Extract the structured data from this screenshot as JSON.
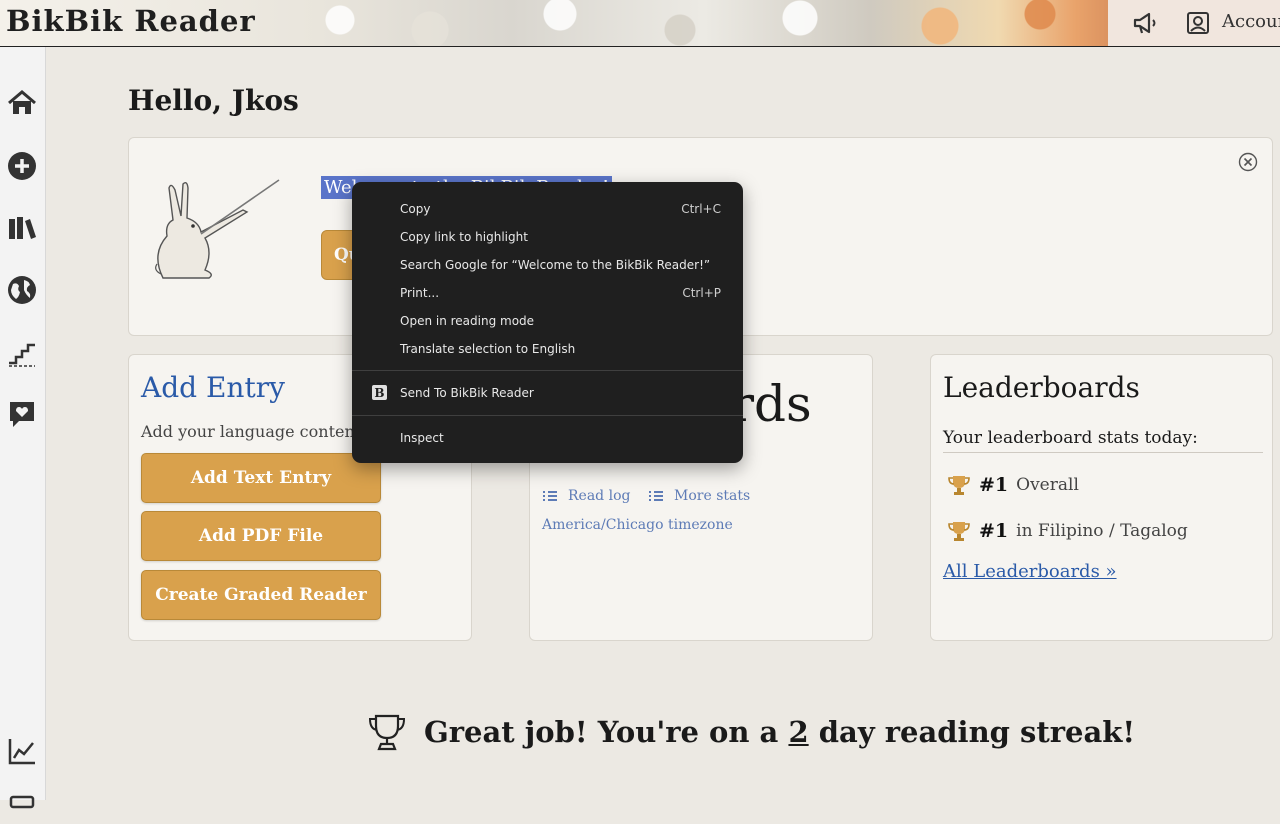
{
  "header": {
    "brand": "BikBik Reader",
    "account_label": "Account"
  },
  "sidebar": {
    "items": [
      "home-icon",
      "add-circle-icon",
      "library-icon",
      "globe-icon",
      "stairs-icon",
      "heart-chat-icon",
      "stats-chart-icon"
    ]
  },
  "greeting": "Hello, Jkos",
  "welcome": {
    "selected_text": "Welcome to the BikBik Reader!",
    "quick_button": "Qu"
  },
  "add_entry": {
    "title": "Add Entry",
    "desc": "Add your language content h",
    "buttons": [
      "Add Text Entry",
      "Add PDF File",
      "Create Graded Reader"
    ]
  },
  "stats": {
    "big_text": "ords",
    "read_log": "Read log",
    "more_stats": "More stats",
    "timezone": "America/Chicago timezone"
  },
  "leaderboards": {
    "title": "Leaderboards",
    "subtitle": "Your leaderboard stats today:",
    "rows": [
      {
        "rank": "#1",
        "label": "Overall"
      },
      {
        "rank": "#1",
        "label": "in Filipino / Tagalog"
      }
    ],
    "all_link": "All Leaderboards »"
  },
  "streak": {
    "prefix": "Great job! You're on a",
    "days": "2",
    "suffix": "day reading streak!"
  },
  "context_menu": {
    "items": [
      {
        "label": "Copy",
        "shortcut": "Ctrl+C"
      },
      {
        "label": "Copy link to highlight",
        "shortcut": ""
      },
      {
        "label": "Search Google for “Welcome to the BikBik Reader!”",
        "shortcut": ""
      },
      {
        "label": "Print...",
        "shortcut": "Ctrl+P"
      },
      {
        "label": "Open in reading mode",
        "shortcut": ""
      },
      {
        "label": "Translate selection to English",
        "shortcut": ""
      }
    ],
    "extension_item": "Send To BikBik Reader",
    "inspect": "Inspect"
  },
  "colors": {
    "accent_button": "#d9a14c",
    "link": "#2a5aa8",
    "menu_bg": "#1f1f1f",
    "selection": "#5a74c9"
  }
}
